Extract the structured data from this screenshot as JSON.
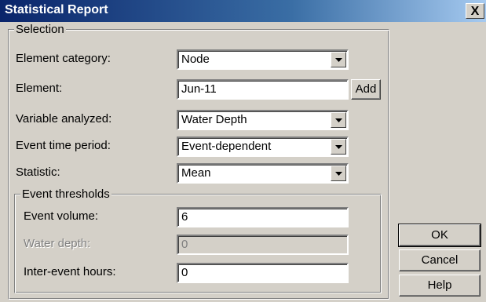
{
  "window": {
    "title": "Statistical Report",
    "close_label": "X"
  },
  "selection": {
    "group_label": "Selection",
    "element_category": {
      "label": "Element category:",
      "value": "Node"
    },
    "element": {
      "label": "Element:",
      "value": "Jun-11",
      "add_label": "Add"
    },
    "variable_analyzed": {
      "label": "Variable analyzed:",
      "value": "Water Depth"
    },
    "event_time_period": {
      "label": "Event time period:",
      "value": "Event-dependent"
    },
    "statistic": {
      "label": "Statistic:",
      "value": "Mean"
    }
  },
  "thresholds": {
    "group_label": "Event thresholds",
    "event_volume": {
      "label": "Event volume:",
      "value": "6"
    },
    "water_depth": {
      "label": "Water depth:",
      "value": "0"
    },
    "inter_event_hours": {
      "label": "Inter-event hours:",
      "value": "0"
    }
  },
  "buttons": {
    "ok": "OK",
    "cancel": "Cancel",
    "help": "Help"
  }
}
